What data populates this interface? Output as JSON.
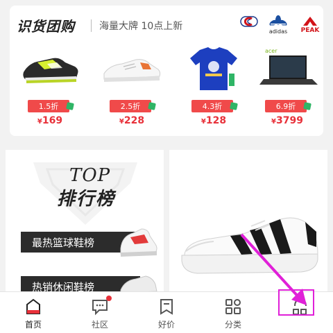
{
  "group_buy": {
    "title": "识货团购",
    "subtitle": "海量大牌 10点上新",
    "brands": [
      {
        "name": "champion-logo",
        "label": ""
      },
      {
        "name": "adidas-logo",
        "label": "adidas"
      },
      {
        "name": "peak-logo",
        "label": "PEAK"
      }
    ],
    "products": [
      {
        "discount": "1.5折",
        "currency": "¥",
        "price": "169",
        "image": "running-shoe"
      },
      {
        "discount": "2.5折",
        "currency": "¥",
        "price": "228",
        "image": "white-sneaker"
      },
      {
        "discount": "4.3折",
        "currency": "¥",
        "price": "128",
        "image": "blue-tshirt"
      },
      {
        "discount": "6.9折",
        "currency": "¥",
        "price": "3799",
        "image": "acer-laptop"
      }
    ]
  },
  "ranking": {
    "title_en": "TOP",
    "title_cn": "排行榜",
    "items": [
      {
        "label": "最热篮球鞋榜"
      },
      {
        "label": "热销休闲鞋榜"
      }
    ]
  },
  "feature": {
    "image": "adidas-superstar-shoe"
  },
  "bottom_nav": {
    "items": [
      {
        "label": "首页",
        "icon": "home-icon",
        "active": true
      },
      {
        "label": "社区",
        "icon": "chat-icon",
        "active": false,
        "badge": true
      },
      {
        "label": "好价",
        "icon": "bookmark-icon",
        "active": false
      },
      {
        "label": "分类",
        "icon": "grid-icon",
        "active": false
      },
      {
        "label": "",
        "icon": "profile-icon",
        "active": false
      }
    ]
  },
  "colors": {
    "accent_red": "#e8313a",
    "discount_bg": "#f04a4a",
    "annotation": "#e020d8"
  }
}
